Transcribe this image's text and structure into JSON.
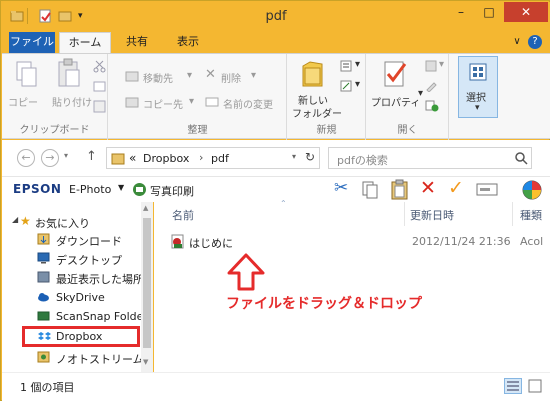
{
  "window": {
    "title": "pdf"
  },
  "ribbon_tabs": {
    "file": "ファイル",
    "home": "ホーム",
    "share": "共有",
    "view": "表示"
  },
  "ribbon": {
    "clipboard": {
      "copy": "コピー",
      "paste": "貼り付け",
      "group": "クリップボード"
    },
    "organize": {
      "move_to": "移動先",
      "copy_to": "コピー先",
      "delete": "削除",
      "rename": "名前の変更",
      "group": "整理"
    },
    "new": {
      "new_folder_line1": "新しい",
      "new_folder_line2": "フォルダー",
      "group": "新規"
    },
    "open": {
      "properties": "プロパティ",
      "group": "開く"
    },
    "select": {
      "select": "選択"
    }
  },
  "address": {
    "prefix": "«",
    "crumb1": "Dropbox",
    "sep": "›",
    "crumb2": "pdf",
    "search_placeholder": "pdfの検索"
  },
  "epson_toolbar": {
    "brand": "EPSON",
    "app": "E-Photo",
    "print": "写真印刷"
  },
  "nav_pane": {
    "items": [
      {
        "label": "お気に入り"
      },
      {
        "label": "ダウンロード"
      },
      {
        "label": "デスクトップ"
      },
      {
        "label": "最近表示した場所"
      },
      {
        "label": "SkyDrive"
      },
      {
        "label": "ScanSnap Folder"
      },
      {
        "label": "Dropbox"
      },
      {
        "label": "ノオトストリーム"
      }
    ]
  },
  "file_list": {
    "headers": {
      "name": "名前",
      "modified": "更新日時",
      "type": "種類"
    },
    "rows": [
      {
        "name": "はじめに",
        "modified": "2012/11/24 21:36",
        "type": "Acol"
      }
    ]
  },
  "annotation": {
    "text": "ファイルをドラッグ＆ドロップ",
    "color": "#e52b2b"
  },
  "status": {
    "count": "1 個の項目"
  },
  "colors": {
    "frame": "#f4b731",
    "file_tab": "#1e62b5",
    "close": "#c7402d",
    "highlight": "#e52b2b"
  }
}
